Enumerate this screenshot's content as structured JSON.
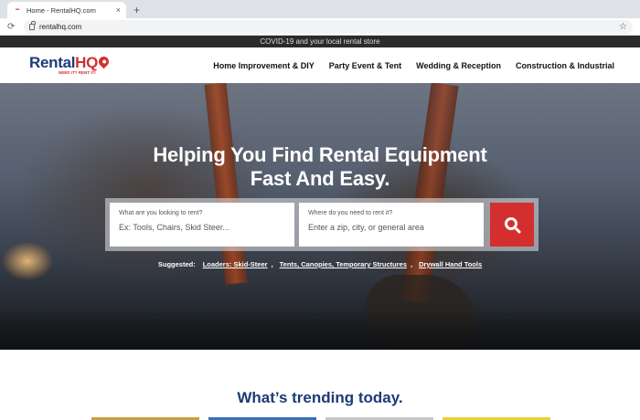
{
  "browser": {
    "tab_title": "Home - RentalHQ.com",
    "tab_close": "×",
    "new_tab": "+",
    "url": "rentalhq.com",
    "reload_icon": "⟳",
    "bookmark_icon": "☆"
  },
  "announcement": "COVID-19 and your local rental store",
  "logo": {
    "main": "Rental",
    "hq": "HQ",
    "tagline": "NEED IT? RENT IT!"
  },
  "nav": [
    "Home Improvement & DIY",
    "Party Event & Tent",
    "Wedding & Reception",
    "Construction & Industrial"
  ],
  "hero": {
    "title_line1": "Helping You Find Rental Equipment",
    "title_line2": "Fast And Easy."
  },
  "search": {
    "what_label": "What are you looking to rent?",
    "what_placeholder": "Ex: Tools, Chairs, Skid Steer...",
    "where_label": "Where do you need to rent it?",
    "where_placeholder": "Enter a zip, city, or general area"
  },
  "suggested": {
    "label": "Suggested:",
    "items": [
      "Loaders: Skid-Steer",
      "Tents, Canopies, Temporary Structures",
      "Drywall Hand Tools"
    ],
    "separator": ","
  },
  "trending": {
    "title": "What’s trending today."
  },
  "colors": {
    "brand_blue": "#1d3a78",
    "brand_red": "#d32f2f"
  },
  "thumb_colors": [
    "#c9a048",
    "#3b6fb8",
    "#c8c8c8",
    "#e8d23a"
  ]
}
